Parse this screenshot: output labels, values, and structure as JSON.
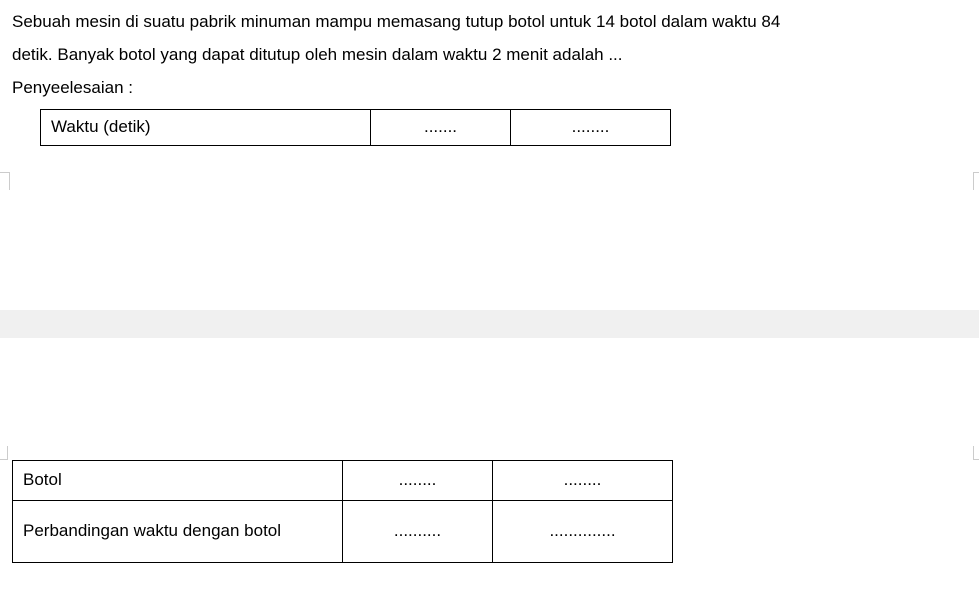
{
  "problem": {
    "line1": "Sebuah mesin di suatu pabrik minuman mampu memasang tutup botol untuk 14 botol dalam waktu 84",
    "line2": "detik. Banyak botol yang dapat ditutup oleh mesin dalam waktu 2 menit adalah ..."
  },
  "solution_label": "Penyeelesaian :",
  "table1": {
    "row1": {
      "label": "Waktu (detik)",
      "c2": ".......",
      "c3": "........"
    }
  },
  "table2": {
    "row1": {
      "label": "Botol",
      "c2": "........",
      "c3": "........"
    },
    "row2": {
      "label": "Perbandingan waktu  dengan botol",
      "c2": "..........",
      "c3": ".............."
    }
  }
}
